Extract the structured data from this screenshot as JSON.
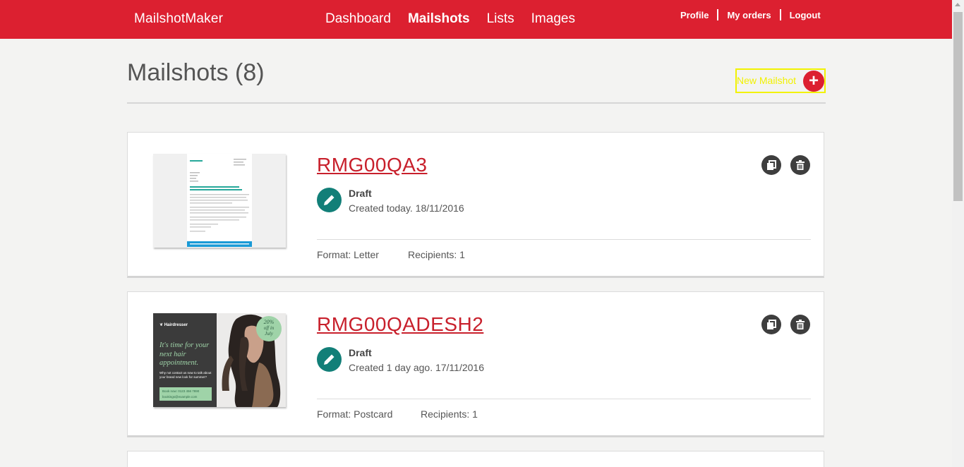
{
  "header": {
    "brand": "MailshotMaker",
    "nav": [
      "Dashboard",
      "Mailshots",
      "Lists",
      "Images"
    ],
    "active_nav": "Mailshots",
    "user_links": [
      "Profile",
      "My orders",
      "Logout"
    ],
    "bg_color": "#dc2030"
  },
  "page": {
    "title": "Mailshots (8)",
    "new_button_label": "New Mailshot",
    "new_button_icon": "plus-icon"
  },
  "mailshots": [
    {
      "name": "RMG00QA3",
      "status": "Draft",
      "created": "Created today. 18/11/2016",
      "format": "Format: Letter",
      "recipients": "Recipients: 1",
      "thumbnail": {
        "kind": "letter",
        "footer_text": "Lorem ipsum dolor sit amet, call 0000 000 000"
      }
    },
    {
      "name": "RMG00QADESH2",
      "status": "Draft",
      "created": "Created 1 day ago. 17/11/2016",
      "format": "Format: Postcard",
      "recipients": "Recipients: 1",
      "thumbnail": {
        "kind": "postcard",
        "brand": "Hairdresser",
        "headline": "It's time for your next hair appointment.",
        "body": "Why not contact us now to talk about your brand new look for summer?",
        "phone": "Book now: 0123 456 7890",
        "email": "bookings@example.com",
        "badge_line1": "20%",
        "badge_line2": "off in",
        "badge_line3": "July"
      }
    }
  ],
  "colors": {
    "accent": "#dc2030",
    "status_teal": "#127f78",
    "action_dark": "#3e3e3e",
    "highlight": "#f2f200"
  }
}
